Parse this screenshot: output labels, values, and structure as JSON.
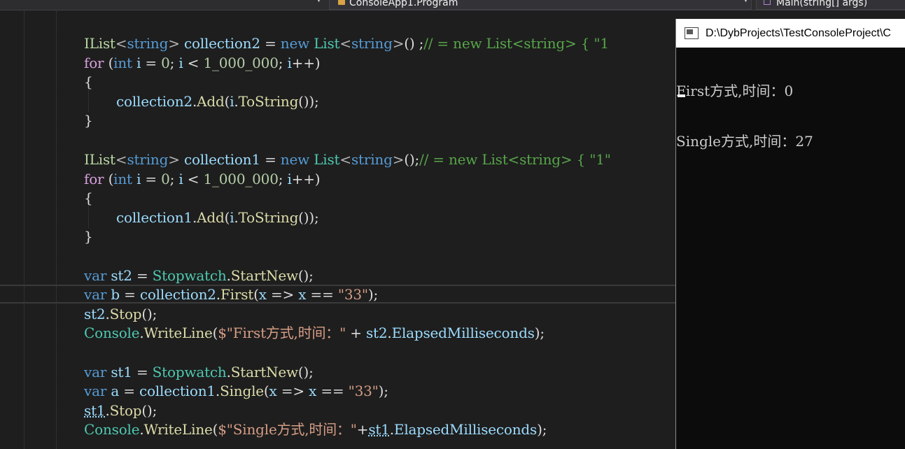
{
  "navigation": {
    "type_dropdown": "ConsoleApp1.Program",
    "member_dropdown": "Main(string[] args)"
  },
  "code": {
    "line_collection2_decl": {
      "type": "IList",
      "generic": "string",
      "name": "collection2",
      "op": "=",
      "kw_new": "new",
      "ctor": "List",
      "ctor_generic": "string",
      "tail": "()",
      "semi": " ;",
      "comment": "// = new List<string> { \"1"
    },
    "line_for1": "for",
    "line_for1_rest": "(int i = 0; i < 1_000_000; i++)",
    "brace_open": "{",
    "brace_close": "}",
    "line_add2": "collection2.Add(i.ToString());",
    "line_collection1_decl": {
      "type": "IList",
      "generic": "string",
      "name": "collection1",
      "op": "=",
      "kw_new": "new",
      "ctor": "List",
      "ctor_generic": "string",
      "tail": "();",
      "comment": "// = new List<string> { \"1\""
    },
    "line_add1": "collection1.Add(i.ToString());",
    "kw_var": "var",
    "kw_int": "int",
    "stopwatch": "Stopwatch",
    "start_new": "StartNew",
    "console_class": "Console",
    "write_line": "WriteLine",
    "st2": "st2",
    "st1": "st1",
    "b": "b",
    "a": "a",
    "collection2": "collection2",
    "collection1": "collection1",
    "first": "First",
    "single": "Single",
    "lambda_x": "x",
    "lambda_arrow": "=>",
    "eq_eq": "==",
    "str_33": "\"33\"",
    "stop": "Stop",
    "first_str": "$\"First方式,时间：\"",
    "single_str": "$\"Single方式,时间：\"",
    "elapsed": "ElapsedMilliseconds"
  },
  "console_window": {
    "title": "D:\\DybProjects\\TestConsoleProject\\C",
    "output_lines": [
      "First方式,时间：0",
      "Single方式,时间：27"
    ]
  }
}
